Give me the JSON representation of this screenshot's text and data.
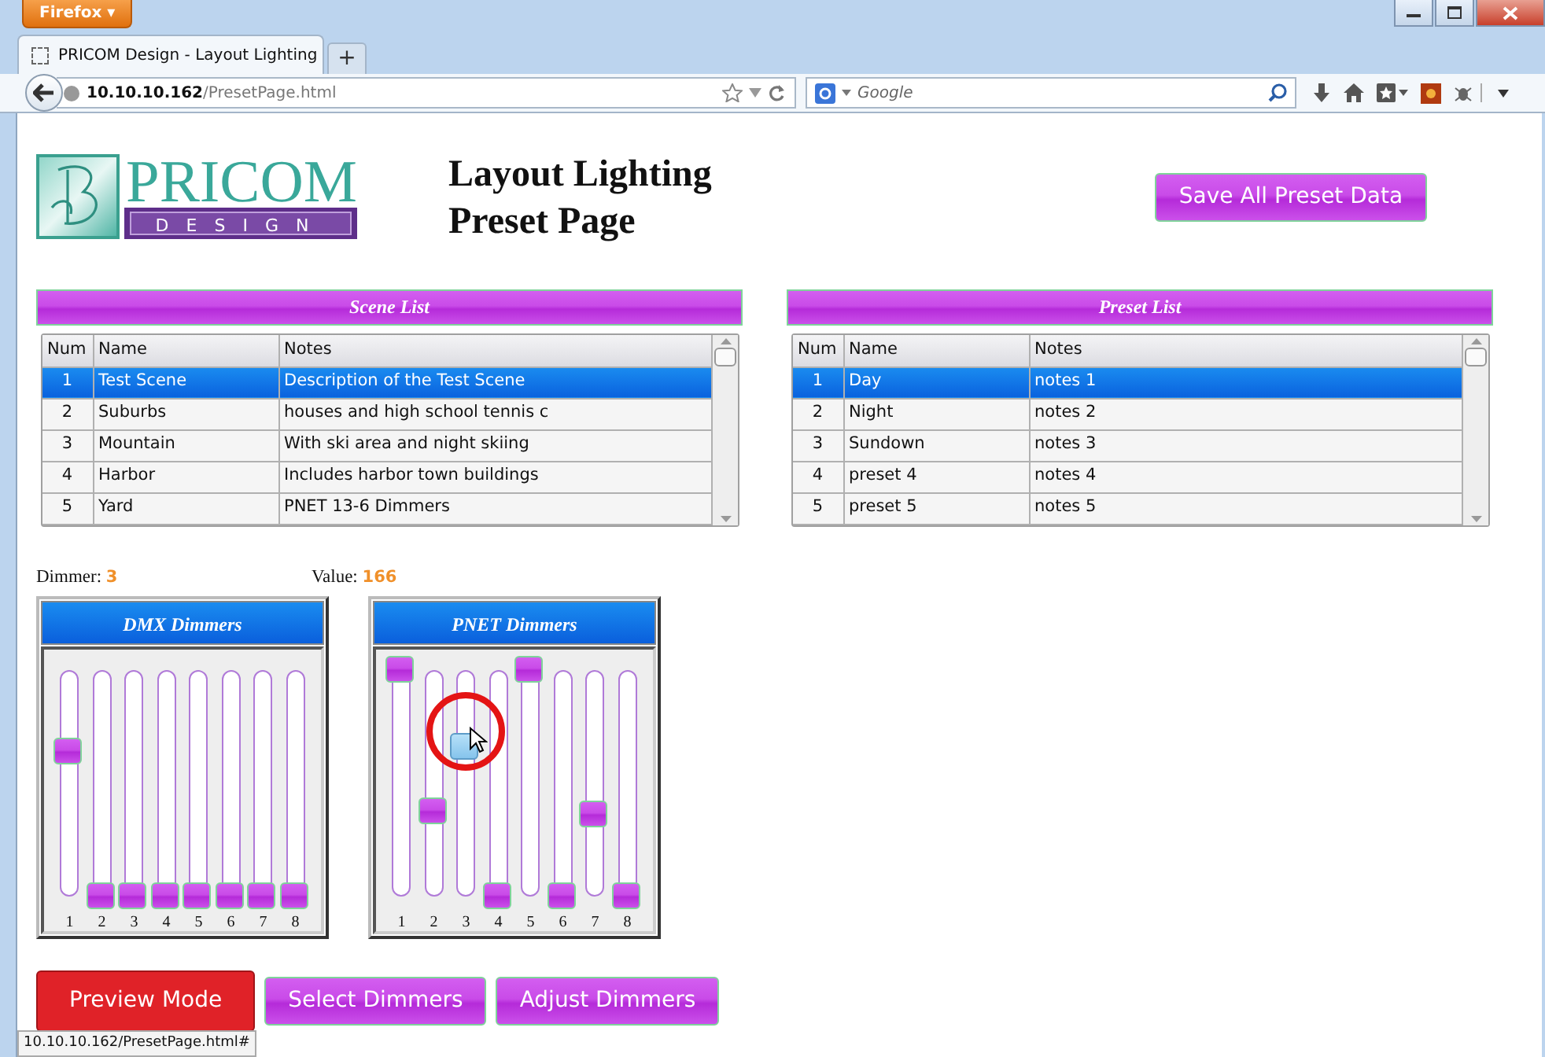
{
  "browser": {
    "menu_button": "Firefox ▾",
    "tab_title": "PRICOM Design - Layout Lighting",
    "new_tab": "+",
    "url_host": "10.10.10.162",
    "url_path": "/PresetPage.html",
    "search_placeholder": "Google",
    "status_url": "10.10.10.162/PresetPage.html#"
  },
  "logo": {
    "name": "PRICOM",
    "sub": "DESIGN"
  },
  "title_lines": [
    "Layout Lighting",
    "Preset Page"
  ],
  "save_button": "Save All Preset Data",
  "lists": [
    {
      "title": "Scene List",
      "columns": [
        "Num",
        "Name",
        "Notes"
      ],
      "rows": [
        {
          "cells": [
            "1",
            "Test Scene",
            "Description of the Test Scene"
          ],
          "selected": true
        },
        {
          "cells": [
            "2",
            "Suburbs",
            "houses and high school tennis c"
          ],
          "selected": false
        },
        {
          "cells": [
            "3",
            "Mountain",
            "With ski area and night skiing"
          ],
          "selected": false
        },
        {
          "cells": [
            "4",
            "Harbor",
            "Includes harbor town buildings"
          ],
          "selected": false
        },
        {
          "cells": [
            "5",
            "Yard",
            "PNET 13-6 Dimmers"
          ],
          "selected": false
        }
      ]
    },
    {
      "title": "Preset List",
      "columns": [
        "Num",
        "Name",
        "Notes"
      ],
      "rows": [
        {
          "cells": [
            "1",
            "Day",
            "notes 1"
          ],
          "selected": true
        },
        {
          "cells": [
            "2",
            "Night",
            "notes 2"
          ],
          "selected": false
        },
        {
          "cells": [
            "3",
            "Sundown",
            "notes 3"
          ],
          "selected": false
        },
        {
          "cells": [
            "4",
            "preset 4",
            "notes 4"
          ],
          "selected": false
        },
        {
          "cells": [
            "5",
            "preset 5",
            "notes 5"
          ],
          "selected": false
        }
      ]
    }
  ],
  "readouts": [
    {
      "label": "Dimmer:",
      "value": "3"
    },
    {
      "label": "Value:",
      "value": "166"
    }
  ],
  "panels": [
    {
      "title": "DMX Dimmers",
      "sliders": [
        {
          "label": "1",
          "level": 0.64,
          "active": false
        },
        {
          "label": "2",
          "level": 0,
          "active": false
        },
        {
          "label": "3",
          "level": 0,
          "active": false
        },
        {
          "label": "4",
          "level": 0,
          "active": false
        },
        {
          "label": "5",
          "level": 0,
          "active": false
        },
        {
          "label": "6",
          "level": 0,
          "active": false
        },
        {
          "label": "7",
          "level": 0,
          "active": false
        },
        {
          "label": "8",
          "level": 0,
          "active": false
        }
      ]
    },
    {
      "title": "PNET Dimmers",
      "sliders": [
        {
          "label": "1",
          "level": 1,
          "active": false
        },
        {
          "label": "2",
          "level": 0.37,
          "active": false
        },
        {
          "label": "3",
          "level": 0.66,
          "active": true
        },
        {
          "label": "4",
          "level": 0,
          "active": false
        },
        {
          "label": "5",
          "level": 1,
          "active": false
        },
        {
          "label": "6",
          "level": 0,
          "active": false
        },
        {
          "label": "7",
          "level": 0.36,
          "active": false
        },
        {
          "label": "8",
          "level": 0,
          "active": false
        }
      ]
    }
  ],
  "mode_buttons": [
    {
      "label": "Preview Mode",
      "selected": true
    },
    {
      "label": "Select Dimmers",
      "selected": false
    },
    {
      "label": "Adjust Dimmers",
      "selected": false
    }
  ]
}
